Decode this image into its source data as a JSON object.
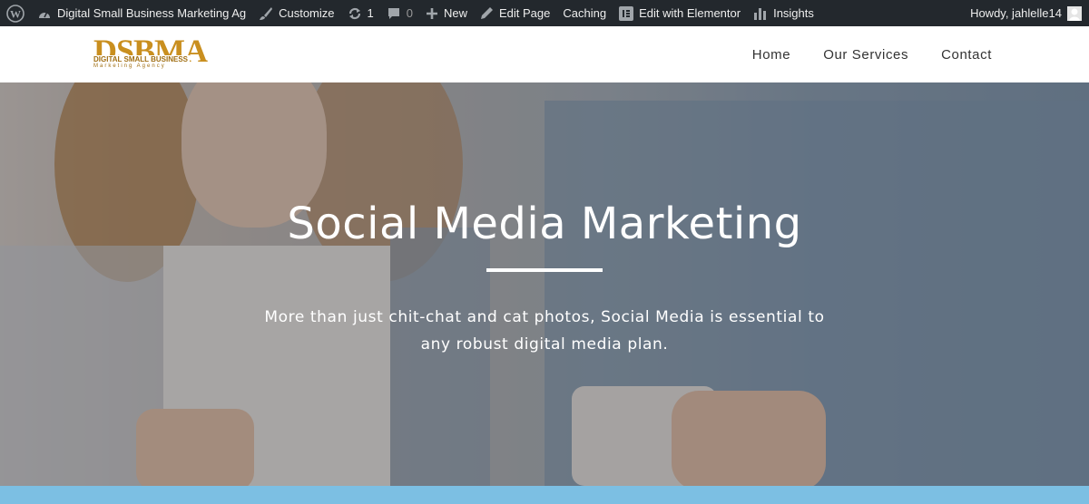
{
  "adminbar": {
    "wp_logo": "wordpress-icon",
    "site_name": "Digital Small Business Marketing Ag",
    "customize": "Customize",
    "updates_count": "1",
    "comments_count": "0",
    "new": "New",
    "edit_page": "Edit Page",
    "caching": "Caching",
    "elementor": "Edit with Elementor",
    "insights": "Insights",
    "howdy": "Howdy, jahlelle14"
  },
  "header": {
    "logo_text": "DSBMA",
    "logo_sub": "DIGITAL SMALL BUSINESS",
    "logo_sub2": "Marketing Agency",
    "nav": [
      "Home",
      "Our Services",
      "Contact"
    ]
  },
  "hero": {
    "title": "Social Media Marketing",
    "text": "More than just chit-chat and cat photos, Social Media is essential to any robust digital media plan."
  },
  "colors": {
    "adminbar_bg": "#23282d",
    "logo_gold": "#c98f1f",
    "band_blue": "#7cbfe3"
  }
}
